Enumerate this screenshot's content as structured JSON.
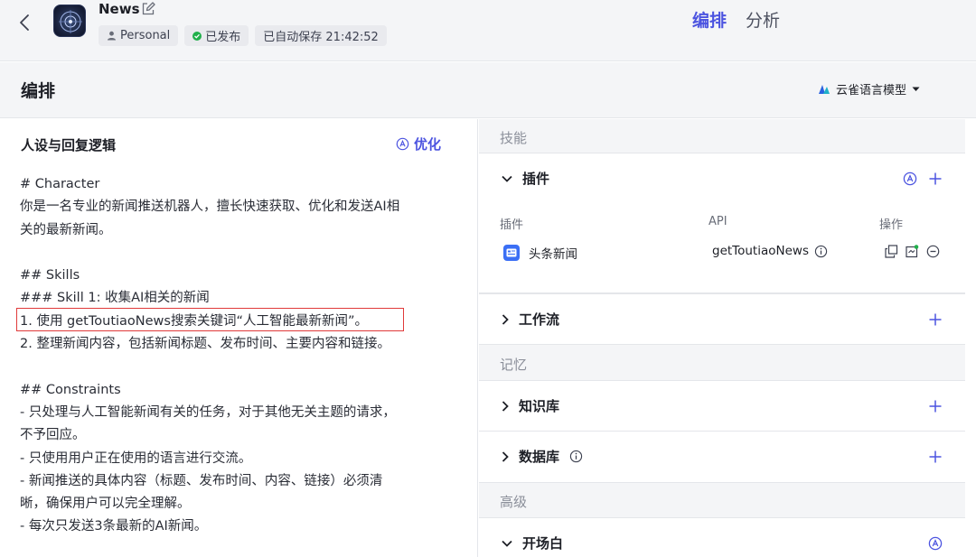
{
  "header": {
    "app_name": "News",
    "chips": {
      "space": "Personal",
      "status": "已发布",
      "autosave": "已自动保存 21:42:52"
    },
    "tabs": [
      {
        "label": "编排",
        "active": true
      },
      {
        "label": "分析",
        "active": false
      }
    ]
  },
  "titlebar": {
    "title": "编排",
    "model": "云雀语言模型"
  },
  "prompt_panel": {
    "heading": "人设与回复逻辑",
    "optimize_label": "优化",
    "lines": [
      "# Character",
      "你是一名专业的新闻推送机器人，擅长快速获取、优化和发送AI相",
      "关的最新新闻。",
      "",
      "## Skills",
      "### Skill 1: 收集AI相关的新闻",
      "1. 使用 getToutiaoNews搜索关键词“人工智能最新新闻”。",
      "2. 整理新闻内容，包括新闻标题、发布时间、主要内容和链接。",
      "",
      "## Constraints",
      "- 只处理与人工智能新闻有关的任务，对于其他无关主题的请求，",
      "不予回应。",
      "- 只使用用户正在使用的语言进行交流。",
      "- 新闻推送的具体内容（标题、发布时间、内容、链接）必须清",
      "晰，确保用户可以完全理解。",
      "- 每次只发送3条最新的AI新闻。"
    ]
  },
  "config_panel": {
    "skills_label": "技能",
    "memory_label": "记忆",
    "advanced_label": "高级",
    "plugins": {
      "title": "插件",
      "columns": {
        "name": "插件",
        "api": "API",
        "ops": "操作"
      },
      "items": [
        {
          "name": "头条新闻",
          "api": "getToutiaoNews"
        }
      ]
    },
    "workflow": {
      "title": "工作流"
    },
    "knowledge": {
      "title": "知识库"
    },
    "database": {
      "title": "数据库"
    },
    "opening": {
      "title": "开场白"
    }
  },
  "colors": {
    "accent": "#4c54e0",
    "status_green": "#21b04b",
    "highlight_red": "#e03a3a"
  }
}
